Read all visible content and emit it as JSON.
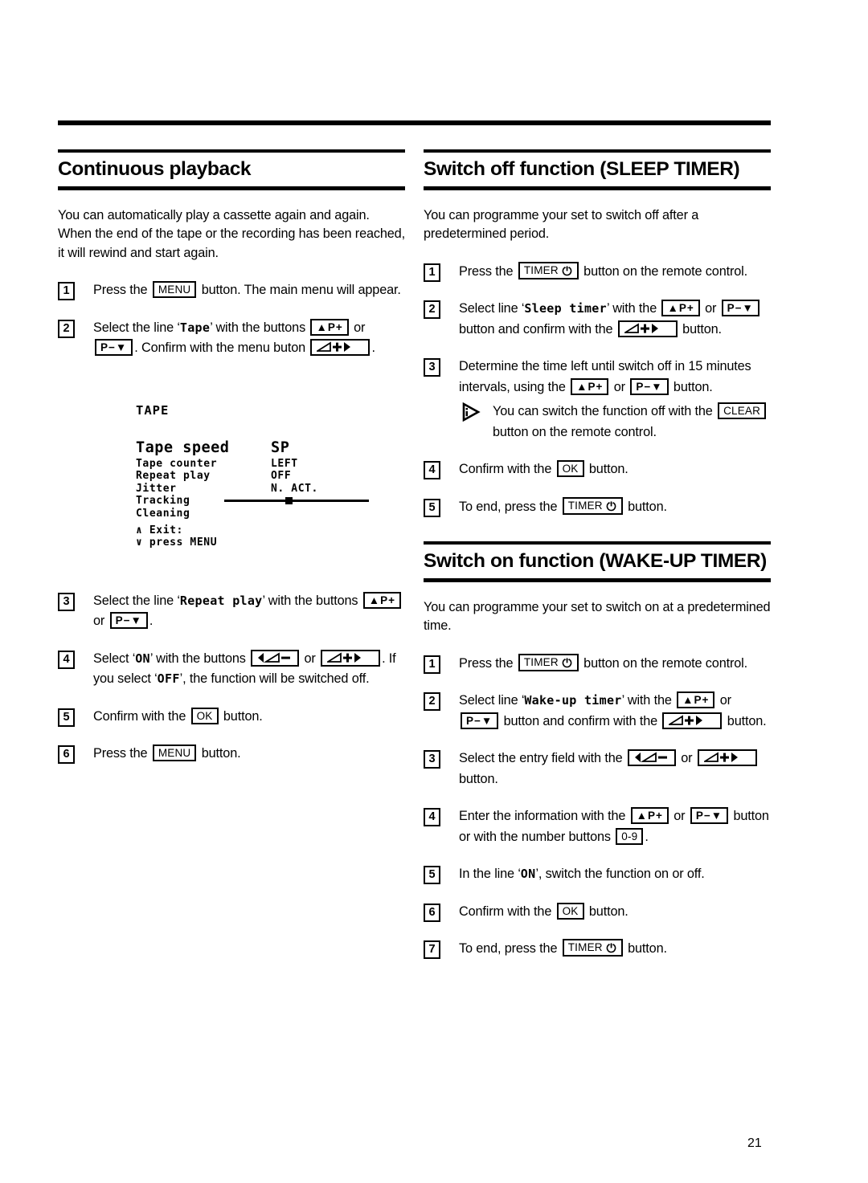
{
  "page": {
    "number": "21"
  },
  "left_column": {
    "heading": "Continuous playback",
    "intro": "You can automatically play a cassette again and again. When the end of the tape or the recording has been reached, it will rewind and start again.",
    "steps": [
      {
        "num": "1",
        "parts": [
          {
            "t": "text",
            "v": "Press the "
          },
          {
            "t": "key",
            "v": "MENU"
          },
          {
            "t": "text",
            "v": " button. The main menu will appear."
          }
        ]
      },
      {
        "num": "2",
        "parts": [
          {
            "t": "text",
            "v": "Select the line ‘"
          },
          {
            "t": "mono",
            "v": "Tape"
          },
          {
            "t": "text",
            "v": "’ with the buttons "
          },
          {
            "t": "key",
            "v": "▲P+"
          },
          {
            "t": "text",
            "v": " or "
          },
          {
            "t": "key",
            "v": "P−▼"
          },
          {
            "t": "text",
            "v": ". Confirm with the menu buton "
          },
          {
            "t": "key",
            "v": "◢+▶"
          },
          {
            "t": "text",
            "v": "."
          }
        ]
      },
      {
        "num": "3",
        "parts": [
          {
            "t": "text",
            "v": "Select the line ‘"
          },
          {
            "t": "mono",
            "v": "Repeat play"
          },
          {
            "t": "text",
            "v": "’ with the buttons "
          },
          {
            "t": "key",
            "v": "▲P+"
          },
          {
            "t": "text",
            "v": " or "
          },
          {
            "t": "key",
            "v": "P−▼"
          },
          {
            "t": "text",
            "v": "."
          }
        ]
      },
      {
        "num": "4",
        "parts": [
          {
            "t": "text",
            "v": "Select ‘"
          },
          {
            "t": "mono",
            "v": "ON"
          },
          {
            "t": "text",
            "v": "’ with the buttons "
          },
          {
            "t": "key",
            "v": "◀◢−"
          },
          {
            "t": "text",
            "v": " or "
          },
          {
            "t": "key",
            "v": "◢+▶"
          },
          {
            "t": "text",
            "v": ". If you select ‘"
          },
          {
            "t": "mono",
            "v": "OFF"
          },
          {
            "t": "text",
            "v": "’, the function will be switched off."
          }
        ]
      },
      {
        "num": "5",
        "parts": [
          {
            "t": "text",
            "v": "Confirm with the "
          },
          {
            "t": "key",
            "v": "OK"
          },
          {
            "t": "text",
            "v": " button."
          }
        ]
      },
      {
        "num": "6",
        "parts": [
          {
            "t": "text",
            "v": "Press the "
          },
          {
            "t": "key",
            "v": "MENU"
          },
          {
            "t": "text",
            "v": " button."
          }
        ]
      }
    ],
    "tv_screen": {
      "title": "TAPE",
      "rows": [
        {
          "label": "Tape speed",
          "value": "SP",
          "large": true
        },
        {
          "label": "Tape counter",
          "value": "LEFT"
        },
        {
          "label": "Repeat play",
          "value": "OFF"
        },
        {
          "label": "Jitter",
          "value": "N. ACT."
        },
        {
          "label": "Tracking",
          "value": "",
          "slider": true
        },
        {
          "label": "Cleaning",
          "value": ""
        }
      ],
      "footer_line1": "∧ Exit:",
      "footer_line2": "∨ press MENU"
    }
  },
  "right_column": {
    "section_sleep": {
      "heading": "Switch off function (SLEEP TIMER)",
      "intro": "You can programme your set to switch off after a predetermined period.",
      "steps": [
        {
          "num": "1",
          "parts": [
            {
              "t": "text",
              "v": "Press the "
            },
            {
              "t": "key",
              "v": "TIMER⏻"
            },
            {
              "t": "text",
              "v": " button on the remote control."
            }
          ]
        },
        {
          "num": "2",
          "parts": [
            {
              "t": "text",
              "v": "Select line ‘"
            },
            {
              "t": "mono",
              "v": "Sleep timer"
            },
            {
              "t": "text",
              "v": "’ with the "
            },
            {
              "t": "key",
              "v": "▲P+"
            },
            {
              "t": "text",
              "v": " or "
            },
            {
              "t": "key",
              "v": "P−▼"
            },
            {
              "t": "text",
              "v": " button and confirm with the "
            },
            {
              "t": "key",
              "v": "◢+▶"
            },
            {
              "t": "text",
              "v": " button."
            }
          ]
        },
        {
          "num": "3",
          "parts": [
            {
              "t": "text",
              "v": "Determine the time left until switch off in 15 minutes intervals, using the "
            },
            {
              "t": "key",
              "v": "▲P+"
            },
            {
              "t": "text",
              "v": " or "
            },
            {
              "t": "key",
              "v": "P−▼"
            },
            {
              "t": "text",
              "v": " button."
            }
          ],
          "note": [
            {
              "t": "text",
              "v": "You can switch the function off with the "
            },
            {
              "t": "key",
              "v": "CLEAR"
            },
            {
              "t": "text",
              "v": " button on the remote control."
            }
          ]
        },
        {
          "num": "4",
          "parts": [
            {
              "t": "text",
              "v": "Confirm with the "
            },
            {
              "t": "key",
              "v": "OK"
            },
            {
              "t": "text",
              "v": " button."
            }
          ]
        },
        {
          "num": "5",
          "parts": [
            {
              "t": "text",
              "v": "To end, press the "
            },
            {
              "t": "key",
              "v": "TIMER⏻"
            },
            {
              "t": "text",
              "v": " button."
            }
          ]
        }
      ]
    },
    "section_wakeup": {
      "heading": "Switch on function (WAKE-UP TIMER)",
      "intro": "You can programme your set to switch on at a predetermined time.",
      "steps": [
        {
          "num": "1",
          "parts": [
            {
              "t": "text",
              "v": "Press the "
            },
            {
              "t": "key",
              "v": "TIMER⏻"
            },
            {
              "t": "text",
              "v": " button on the remote control."
            }
          ]
        },
        {
          "num": "2",
          "parts": [
            {
              "t": "text",
              "v": "Select line ‘"
            },
            {
              "t": "mono",
              "v": "Wake-up timer"
            },
            {
              "t": "text",
              "v": "’ with the "
            },
            {
              "t": "key",
              "v": "▲P+"
            },
            {
              "t": "text",
              "v": " or "
            },
            {
              "t": "key",
              "v": "P−▼"
            },
            {
              "t": "text",
              "v": " button and confirm with the "
            },
            {
              "t": "key",
              "v": "◢+▶"
            },
            {
              "t": "text",
              "v": " button."
            }
          ]
        },
        {
          "num": "3",
          "parts": [
            {
              "t": "text",
              "v": "Select the entry field with the "
            },
            {
              "t": "key",
              "v": "◀◢−"
            },
            {
              "t": "text",
              "v": " or "
            },
            {
              "t": "key",
              "v": "◢+▶"
            },
            {
              "t": "text",
              "v": " button."
            }
          ]
        },
        {
          "num": "4",
          "parts": [
            {
              "t": "text",
              "v": "Enter the information with the "
            },
            {
              "t": "key",
              "v": "▲P+"
            },
            {
              "t": "text",
              "v": " or "
            },
            {
              "t": "key",
              "v": "P−▼"
            },
            {
              "t": "text",
              "v": " button or with the number buttons "
            },
            {
              "t": "key",
              "v": "0-9"
            },
            {
              "t": "text",
              "v": "."
            }
          ]
        },
        {
          "num": "5",
          "parts": [
            {
              "t": "text",
              "v": "In the line ‘"
            },
            {
              "t": "mono",
              "v": "ON"
            },
            {
              "t": "text",
              "v": "’, switch the function on or off."
            }
          ]
        },
        {
          "num": "6",
          "parts": [
            {
              "t": "text",
              "v": "Confirm with the "
            },
            {
              "t": "key",
              "v": "OK"
            },
            {
              "t": "text",
              "v": " button."
            }
          ]
        },
        {
          "num": "7",
          "parts": [
            {
              "t": "text",
              "v": "To end, press the "
            },
            {
              "t": "key",
              "v": "TIMER⏻"
            },
            {
              "t": "text",
              "v": " button."
            }
          ]
        }
      ]
    }
  }
}
